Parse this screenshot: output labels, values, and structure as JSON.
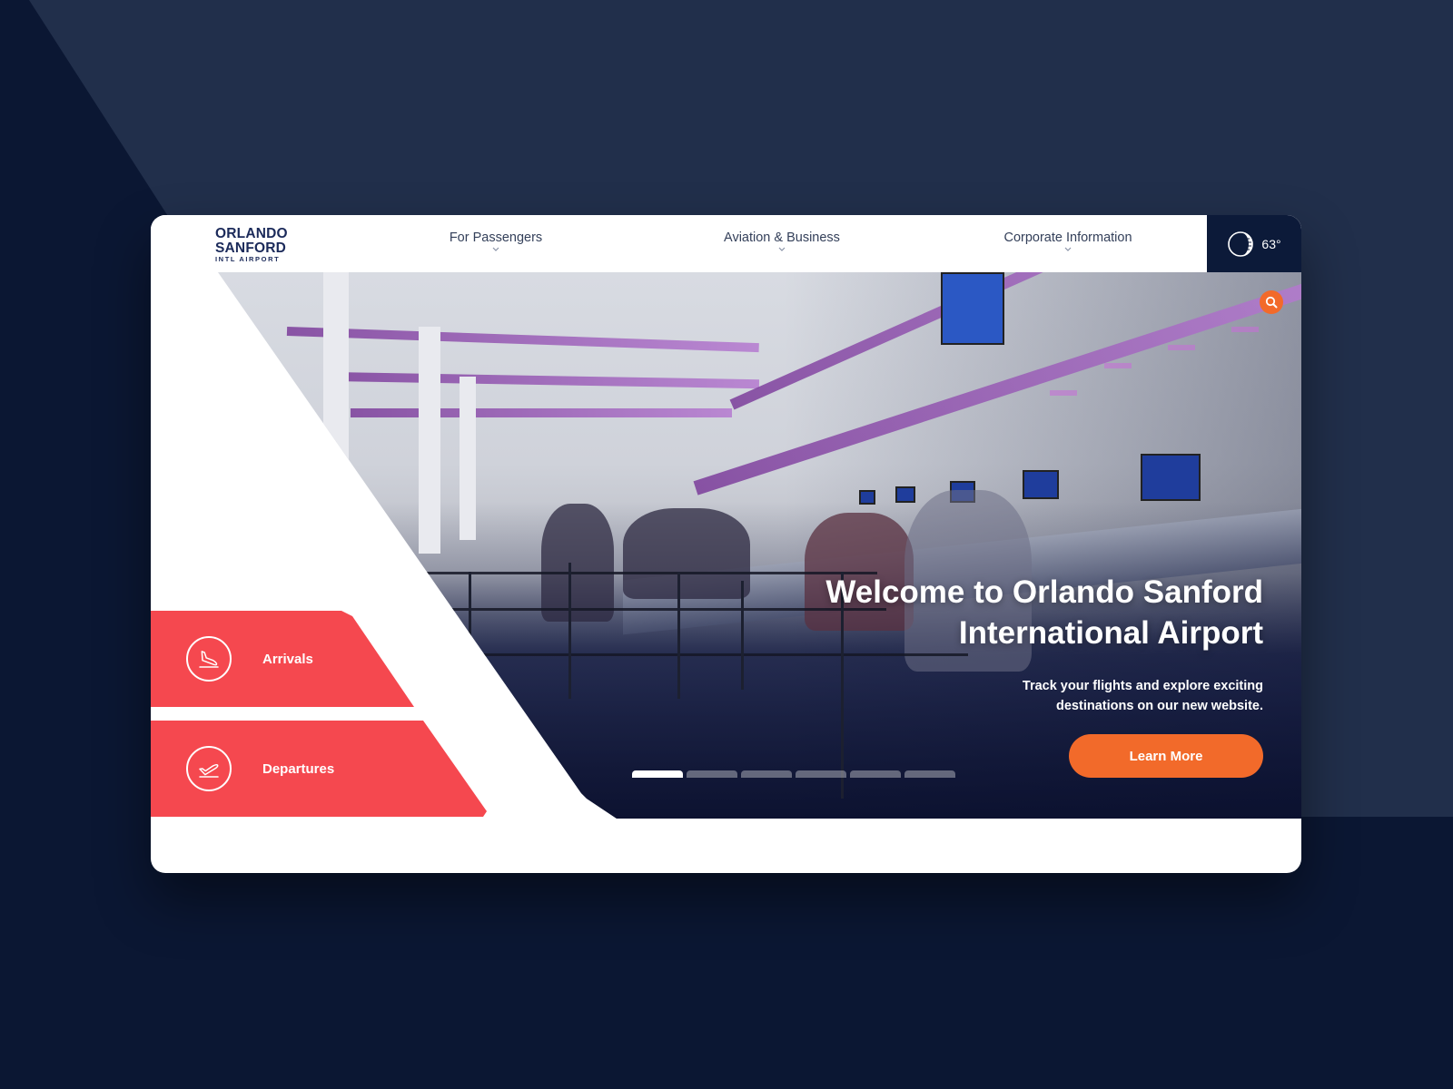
{
  "logo": {
    "line1": "ORLANDO",
    "line2": "SANFORD",
    "line3": "INTL AIRPORT"
  },
  "nav": {
    "items": [
      {
        "label": "For Passengers"
      },
      {
        "label": "Aviation & Business"
      },
      {
        "label": "Corporate Information"
      }
    ]
  },
  "weather": {
    "icon": "moon-icon",
    "temperature": "63°"
  },
  "hero": {
    "title": "Welcome to Orlando Sanford International Airport",
    "subtitle": "Track your flights and explore exciting destinations on our new website.",
    "cta_label": "Learn More",
    "slides": {
      "count": 6,
      "active": 1
    }
  },
  "quick_links": [
    {
      "label": "Arrivals",
      "icon": "arrivals-plane-icon"
    },
    {
      "label": "Departures",
      "icon": "departures-plane-icon"
    }
  ],
  "colors": {
    "navy": "#0c1a39",
    "accent_orange": "#f26a2a",
    "accent_red": "#f5484f",
    "page_background": "#0b1733"
  }
}
